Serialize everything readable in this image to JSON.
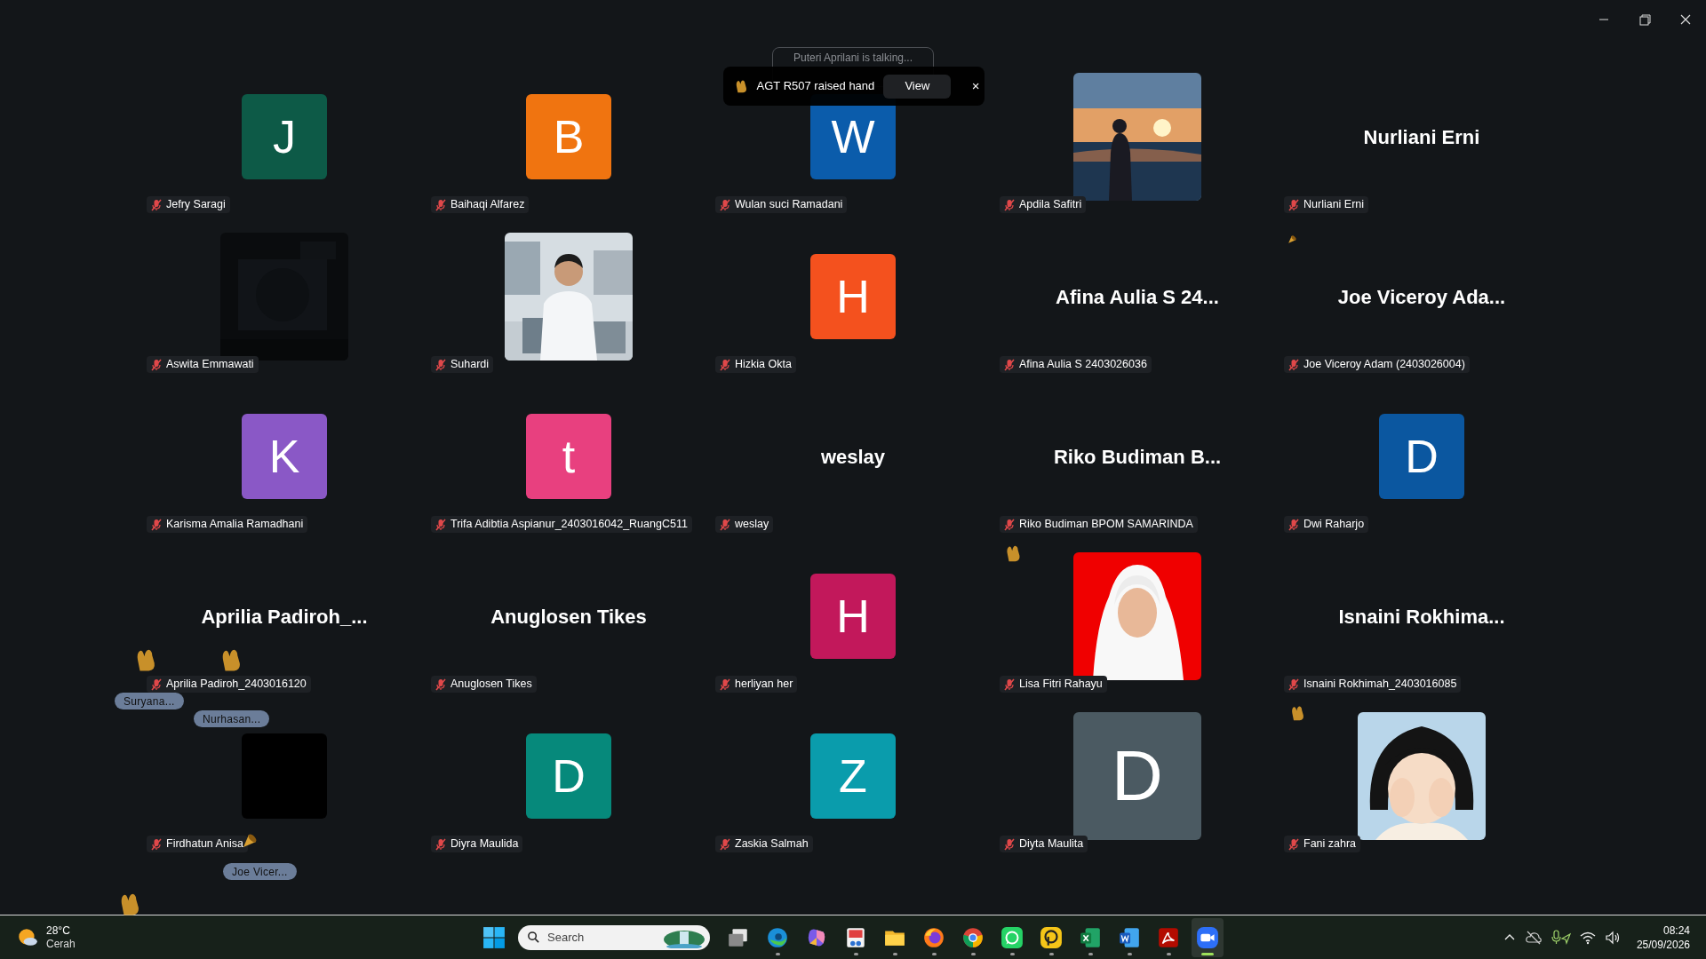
{
  "speaking_notice": "Puteri Aprilani is talking...",
  "notification": {
    "text": "AGT R507 raised hand",
    "action": "View",
    "close": "×"
  },
  "tiles": [
    {
      "kind": "letter",
      "letter": "J",
      "color": "#0d5a47",
      "name": "Jefry Saragi",
      "muted": true
    },
    {
      "kind": "letter",
      "letter": "B",
      "color": "#f07410",
      "name": "Baihaqi Alfarez",
      "muted": true
    },
    {
      "kind": "letter",
      "letter": "W",
      "color": "#0b5cab",
      "name": "Wulan suci Ramadani",
      "muted": true
    },
    {
      "name": "Apdila Safitri",
      "muted": true
    },
    {
      "kind": "name",
      "display_name": "Nurliani Erni",
      "name": "Nurliani Erni",
      "muted": true
    },
    {
      "name": "Aswita Emmawati",
      "muted": true
    },
    {
      "name": "Suhardi",
      "muted": true
    },
    {
      "kind": "letter",
      "letter": "H",
      "color": "#f4511e",
      "name": "Hizkia Okta",
      "muted": true
    },
    {
      "kind": "name",
      "display_name": "Afina Aulia S 24...",
      "name": "Afina Aulia S 2403026036",
      "muted": true
    },
    {
      "kind": "name",
      "display_name": "Joe Viceroy Ada...",
      "name": "Joe Viceroy Adam (2403026004)",
      "muted": true
    },
    {
      "kind": "letter",
      "letter": "K",
      "color": "#8a58c6",
      "name": "Karisma Amalia Ramadhani",
      "muted": true
    },
    {
      "kind": "letter",
      "letter": "t",
      "color": "#e8407f",
      "name": "Trifa Adibtia Aspianur_2403016042_RuangC511",
      "muted": true
    },
    {
      "kind": "name",
      "display_name": "weslay",
      "name": "weslay",
      "muted": true
    },
    {
      "kind": "name",
      "display_name": "Riko Budiman B...",
      "name": "Riko Budiman BPOM SAMARINDA",
      "muted": true
    },
    {
      "kind": "letter",
      "letter": "D",
      "color": "#0b57a0",
      "name": "Dwi Raharjo",
      "muted": true
    },
    {
      "kind": "name",
      "display_name": "Aprilia Padiroh_...",
      "name": "Aprilia Padiroh_2403016120",
      "muted": true
    },
    {
      "kind": "name",
      "display_name": "Anuglosen Tikes",
      "name": "Anuglosen Tikes",
      "muted": true
    },
    {
      "kind": "letter",
      "letter": "H",
      "color": "#c2185b",
      "name": "herliyan her",
      "muted": true
    },
    {
      "name": "Lisa Fitri Rahayu",
      "muted": true
    },
    {
      "kind": "name",
      "display_name": "Isnaini Rokhima...",
      "name": "Isnaini Rokhimah_2403016085",
      "muted": true
    },
    {
      "kind": "blank",
      "name": "Firdhatun Anisa",
      "muted": true
    },
    {
      "kind": "letter",
      "letter": "D",
      "color": "#06897b",
      "name": "Diyra Maulida",
      "muted": true
    },
    {
      "kind": "letter",
      "letter": "Z",
      "color": "#0a9cac",
      "name": "Zaskia Salmah",
      "muted": true
    },
    {
      "kind": "letter_large",
      "letter": "D",
      "color": "#4b5a62",
      "name": "Diyta Maulita",
      "muted": true
    },
    {
      "name": "Fani zahra",
      "muted": true
    }
  ],
  "reaction_labels": [
    "Suryana...",
    "Nurhasan...",
    "Joe Vicer..."
  ],
  "taskbar": {
    "weather": {
      "temp": "28°C",
      "condition": "Cerah"
    },
    "search": {
      "placeholder": "Search"
    },
    "apps": [
      {
        "kind": "taskview",
        "running": false,
        "active": false
      },
      {
        "kind": "edge",
        "running": true,
        "active": false
      },
      {
        "kind": "copilot",
        "running": false,
        "active": false
      },
      {
        "kind": "snip",
        "running": true,
        "active": false
      },
      {
        "kind": "folder",
        "running": true,
        "active": false
      },
      {
        "kind": "firefox",
        "running": true,
        "active": false
      },
      {
        "kind": "chrome",
        "running": true,
        "active": false
      },
      {
        "kind": "whatsapp",
        "running": true,
        "active": false
      },
      {
        "kind": "pcircle",
        "running": true,
        "active": false
      },
      {
        "kind": "excel",
        "running": true,
        "active": false
      },
      {
        "kind": "word",
        "running": true,
        "active": false
      },
      {
        "kind": "acrobat",
        "running": true,
        "active": false
      },
      {
        "kind": "zoom",
        "running": true,
        "active": true
      }
    ],
    "clock": {
      "time": "08:24",
      "date": "25/09/2026"
    }
  }
}
